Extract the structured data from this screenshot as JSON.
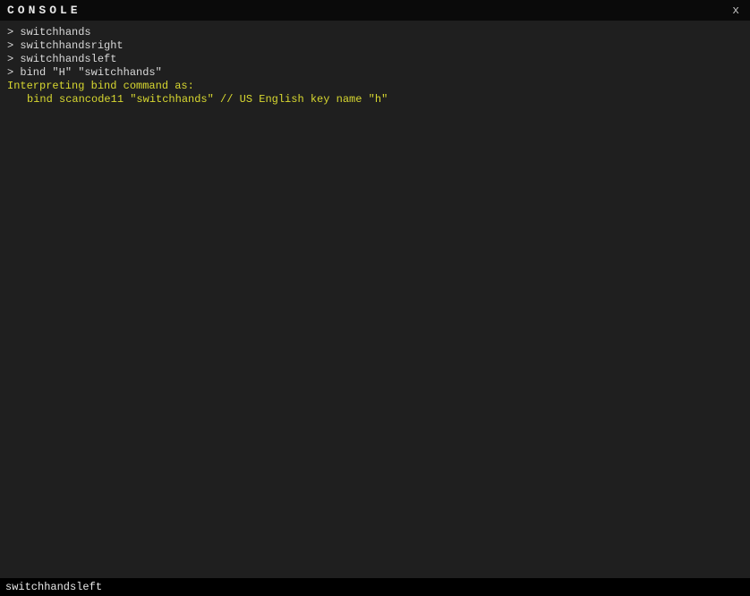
{
  "header": {
    "title": "CONSOLE",
    "close_label": "x"
  },
  "output": {
    "prompt": ">",
    "lines": [
      {
        "type": "cmd",
        "text": "switchhands"
      },
      {
        "type": "cmd",
        "text": "switchhandsright"
      },
      {
        "type": "cmd",
        "text": "switchhandsleft"
      },
      {
        "type": "cmd",
        "text": "bind \"H\" \"switchhands\""
      },
      {
        "type": "info",
        "text": "Interpreting bind command as:"
      },
      {
        "type": "info-indent",
        "text": "bind scancode11 \"switchhands\" // US English key name \"h\""
      }
    ]
  },
  "input": {
    "value": "switchhandsleft"
  }
}
